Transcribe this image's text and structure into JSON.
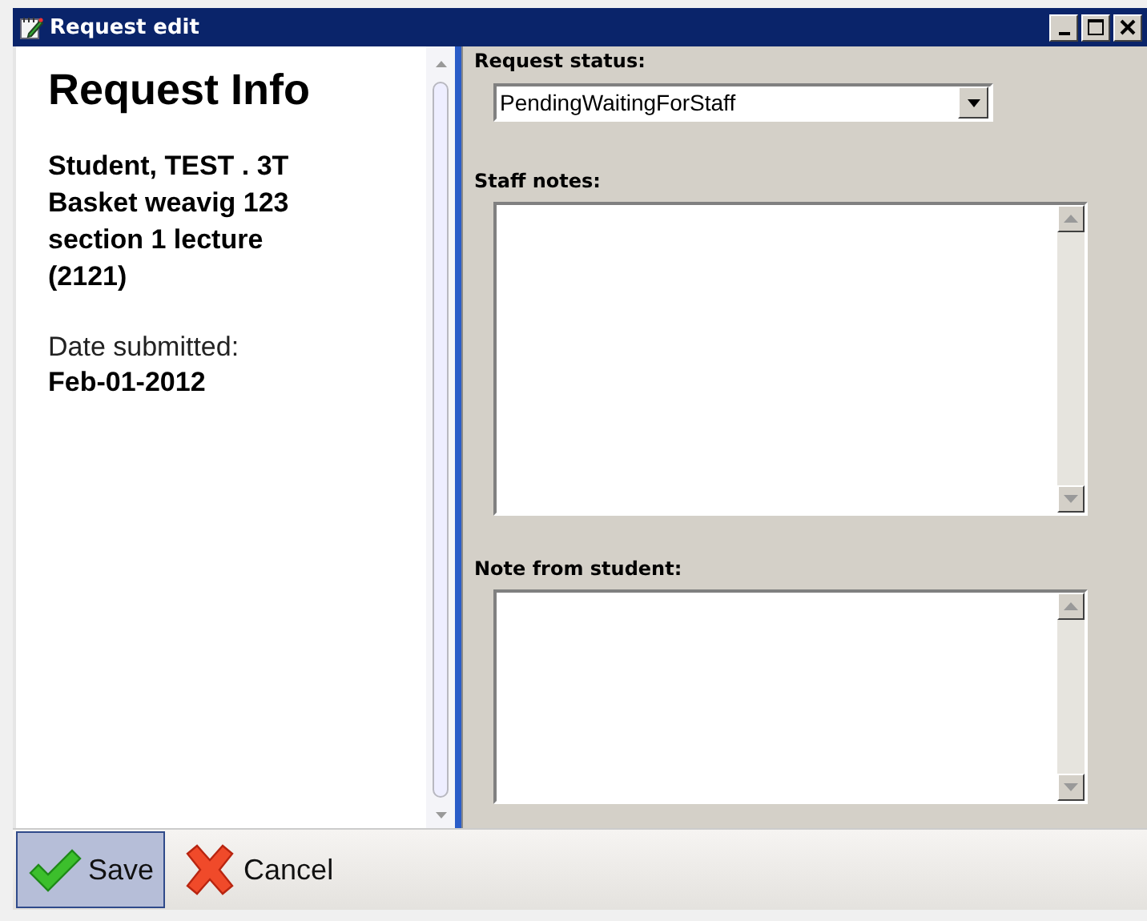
{
  "window": {
    "title": "Request edit"
  },
  "info": {
    "heading": "Request Info",
    "student_lines": [
      "Student, TEST . 3T",
      "Basket weavig 123",
      "section 1 lecture",
      "(2121)"
    ],
    "date_label": "Date submitted:",
    "date_value": "Feb-01-2012"
  },
  "form": {
    "status_label": "Request status:",
    "status_value": "PendingWaitingForStaff",
    "staff_notes_label": "Staff notes:",
    "student_note_label": "Note from student:"
  },
  "toolbar": [
    {
      "kind": "save",
      "label": "Save",
      "selected": true
    },
    {
      "kind": "cancel",
      "label": "Cancel",
      "selected": false
    }
  ]
}
